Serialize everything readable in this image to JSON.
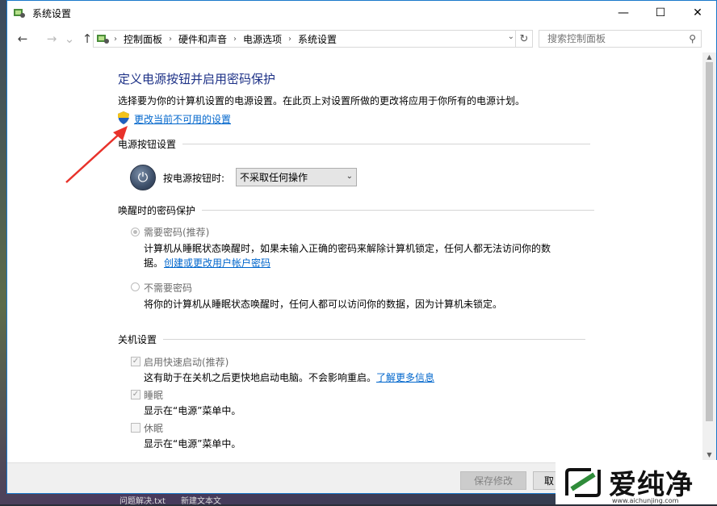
{
  "window": {
    "title": "系统设置"
  },
  "titlebar": {
    "minimize": "—",
    "maximize": "☐",
    "close": "✕"
  },
  "nav": {
    "back": "←",
    "forward": "→",
    "up": "↑",
    "breadcrumb": [
      "控制面板",
      "硬件和声音",
      "电源选项",
      "系统设置"
    ],
    "refresh": "↻",
    "search_placeholder": "搜索控制面板"
  },
  "page": {
    "heading": "定义电源按钮并启用密码保护",
    "description": "选择要为你的计算机设置的电源设置。在此页上对设置所做的更改将应用于你所有的电源计划。",
    "change_unavailable_link": "更改当前不可用的设置"
  },
  "power_button": {
    "section_title": "电源按钮设置",
    "label": "按电源按钮时:",
    "selected_option": "不采取任何操作"
  },
  "wakeup": {
    "section_title": "唤醒时的密码保护",
    "require_password": "需要密码(推荐)",
    "require_desc_line1": "计算机从睡眠状态唤醒时，如果未输入正确的密码来解除计算机锁定，任何人都无法访问你的数",
    "require_desc_line2_prefix": "据。",
    "create_password_link": "创建或更改用户帐户密码",
    "no_password": "不需要密码",
    "no_password_desc": "将你的计算机从睡眠状态唤醒时，任何人都可以访问你的数据，因为计算机未锁定。"
  },
  "shutdown": {
    "section_title": "关机设置",
    "fast_startup": {
      "label": "启用快速启动(推荐)",
      "checked": true,
      "desc": "这有助于在关机之后更快地启动电脑。不会影响重启。",
      "link": "了解更多信息"
    },
    "sleep": {
      "label": "睡眠",
      "checked": true,
      "desc": "显示在“电源”菜单中。"
    },
    "hibernate": {
      "label": "休眠",
      "checked": false,
      "desc": "显示在“电源”菜单中。"
    }
  },
  "footer": {
    "save_button": "保存修改",
    "cancel_button": "取"
  },
  "watermark": {
    "brand": "爱纯净",
    "url": "www.aichunjing.com"
  },
  "taskbar": {
    "items": [
      "问题解决.txt",
      "新建文本文"
    ]
  },
  "colors": {
    "heading": "#1e3287",
    "link": "#0066cc",
    "window_border": "#1979ca"
  }
}
